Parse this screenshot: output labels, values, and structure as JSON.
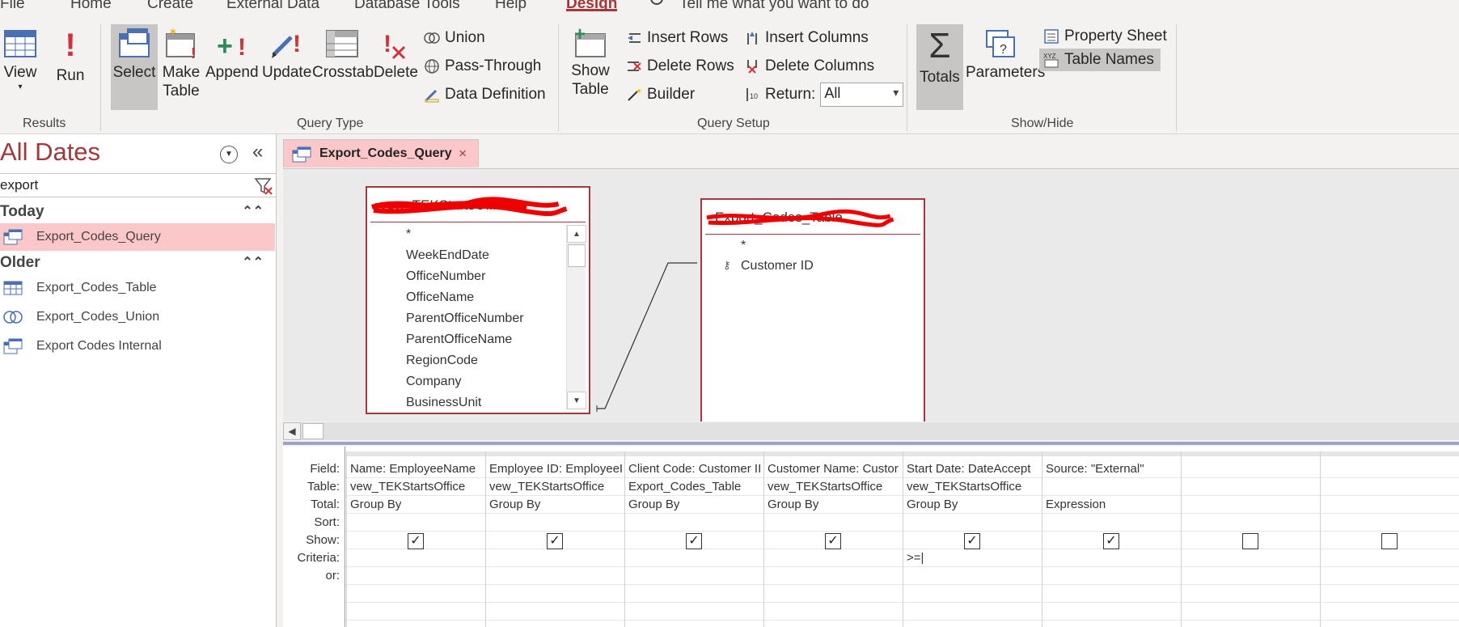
{
  "ribbon_tabs": [
    "File",
    "Home",
    "Create",
    "External Data",
    "Database Tools",
    "Help",
    "Design"
  ],
  "active_tab": "Design",
  "tell_me": "Tell me what you want to do",
  "ribbon": {
    "results": {
      "label": "Results",
      "view": "View",
      "run": "Run"
    },
    "query_type": {
      "label": "Query Type",
      "select": "Select",
      "make_table_1": "Make",
      "make_table_2": "Table",
      "append": "Append",
      "update": "Update",
      "crosstab": "Crosstab",
      "delete": "Delete",
      "union": "Union",
      "pass_through": "Pass-Through",
      "data_definition": "Data Definition"
    },
    "query_setup": {
      "label": "Query Setup",
      "show_table_1": "Show",
      "show_table_2": "Table",
      "insert_rows": "Insert Rows",
      "delete_rows": "Delete Rows",
      "builder": "Builder",
      "insert_columns": "Insert Columns",
      "delete_columns": "Delete Columns",
      "return_label": "Return:",
      "return_value": "All"
    },
    "show_hide": {
      "label": "Show/Hide",
      "totals": "Totals",
      "parameters": "Parameters",
      "property_sheet": "Property Sheet",
      "table_names": "Table Names"
    }
  },
  "nav": {
    "title": "All Dates",
    "search_value": "export",
    "groups": [
      {
        "label": "Today",
        "items": [
          "Export_Codes_Query"
        ]
      },
      {
        "label": "Older",
        "items": [
          "Export_Codes_Table",
          "Export_Codes_Union",
          "Export Codes Internal"
        ]
      }
    ]
  },
  "document": {
    "tab_label": "Export_Codes_Query",
    "close_glyph": "×"
  },
  "field_lists": [
    {
      "title": "vew_TEKStartsOffice",
      "fields": [
        "*",
        "WeekEndDate",
        "OfficeNumber",
        "OfficeName",
        "ParentOfficeNumber",
        "ParentOfficeName",
        "RegionCode",
        "Company",
        "BusinessUnit"
      ]
    },
    {
      "title": "Export_Codes_Table",
      "fields": [
        "*",
        "Customer ID"
      ]
    }
  ],
  "grid": {
    "row_labels": [
      "Field:",
      "Table:",
      "Total:",
      "Sort:",
      "Show:",
      "Criteria:",
      "or:"
    ],
    "columns": [
      {
        "field": "Name: EmployeeName",
        "table": "vew_TEKStartsOffice",
        "total": "Group By",
        "show": true,
        "criteria": ""
      },
      {
        "field": "Employee ID: EmployeeI",
        "table": "vew_TEKStartsOffice",
        "total": "Group By",
        "show": true,
        "criteria": ""
      },
      {
        "field": "Client Code: Customer II",
        "table": "Export_Codes_Table",
        "total": "Group By",
        "show": true,
        "criteria": ""
      },
      {
        "field": "Customer Name: Custor",
        "table": "vew_TEKStartsOffice",
        "total": "Group By",
        "show": true,
        "criteria": ""
      },
      {
        "field": "Start Date: DateAccept",
        "table": "vew_TEKStartsOffice",
        "total": "Group By",
        "show": true,
        "criteria": ">=|"
      },
      {
        "field": "Source: \"External\"",
        "table": "",
        "total": "Expression",
        "show": true,
        "criteria": ""
      },
      {
        "field": "",
        "table": "",
        "total": "",
        "show": false,
        "criteria": ""
      },
      {
        "field": "",
        "table": "",
        "total": "",
        "show": false,
        "criteria": ""
      }
    ]
  },
  "colors": {
    "accent": "#a4373a",
    "selection": "#fbc7c9",
    "ribbon_bg": "#f3f2f1"
  }
}
